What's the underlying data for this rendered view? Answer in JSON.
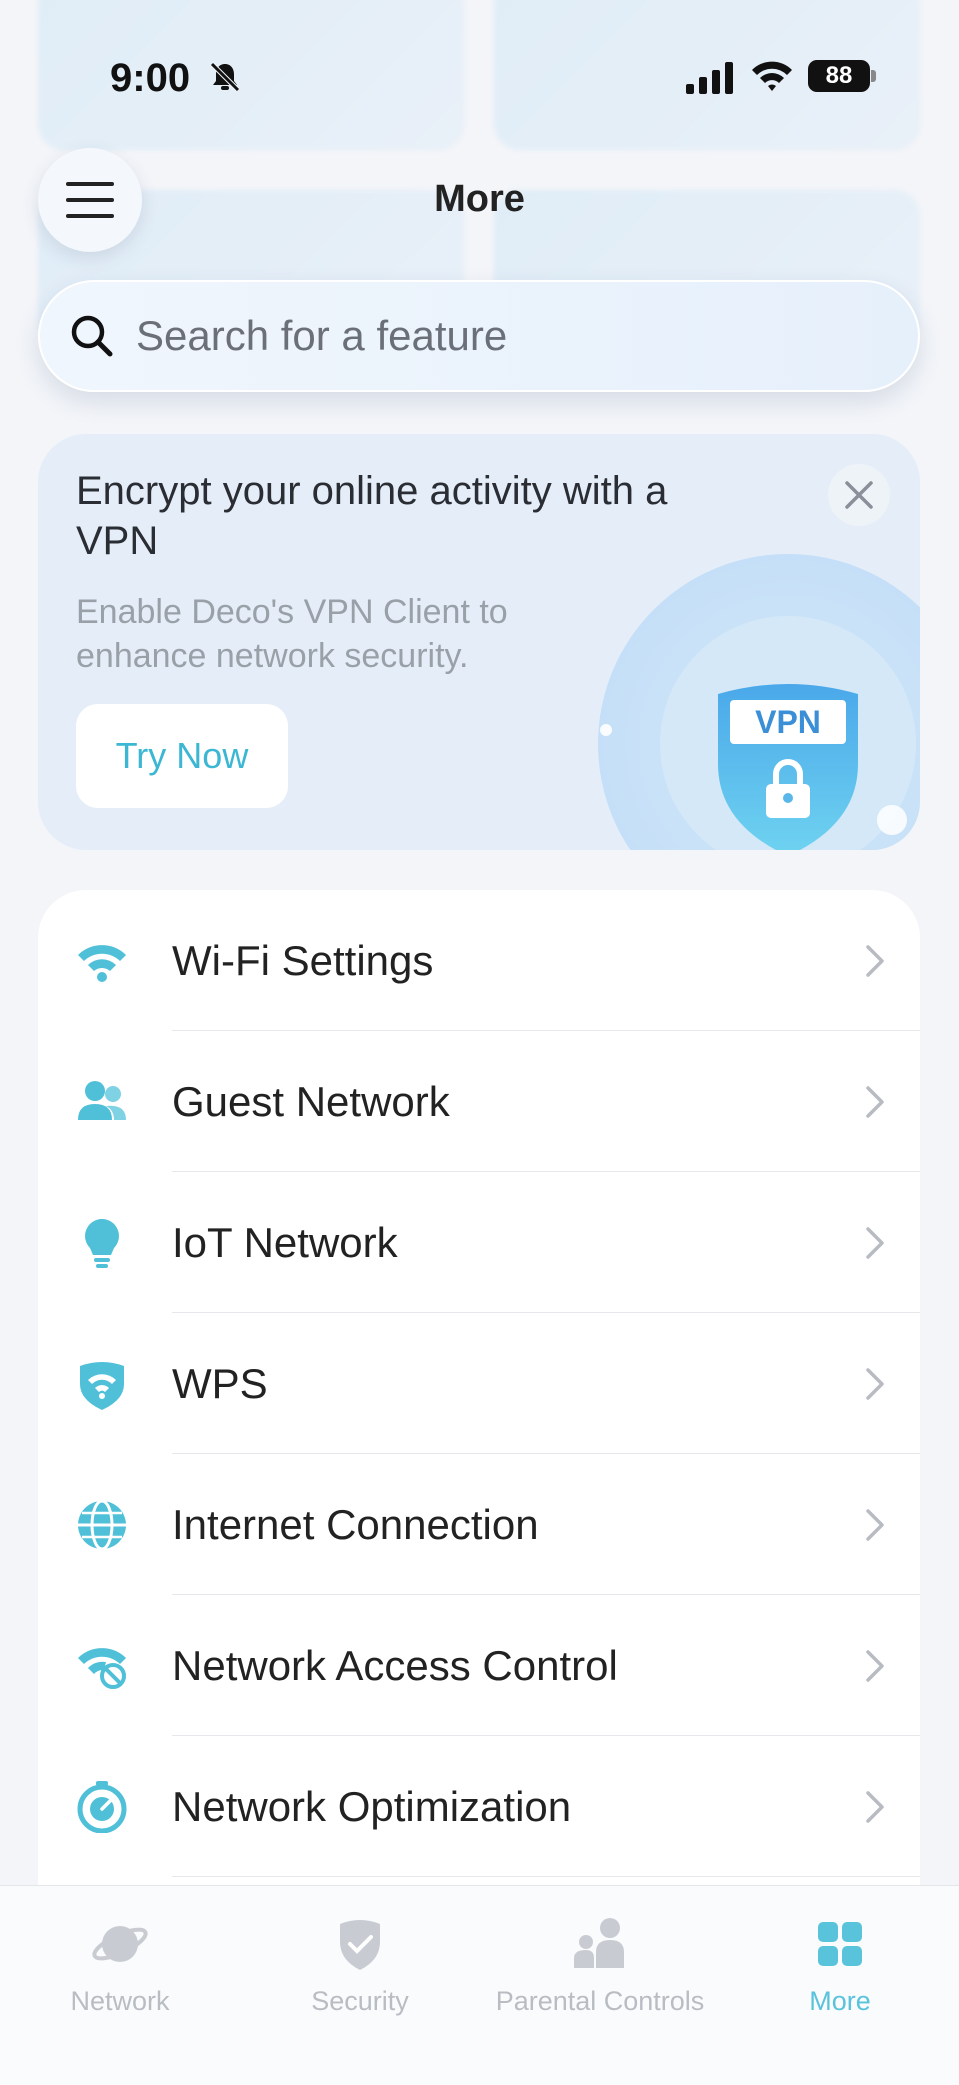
{
  "status_bar": {
    "time": "9:00",
    "battery": "88"
  },
  "header": {
    "title": "More",
    "search_placeholder": "Search for a feature"
  },
  "vpn_promo": {
    "title": "Encrypt your online activity with a VPN",
    "description": "Enable Deco's VPN Client to enhance network security.",
    "button": "Try Now",
    "badge_text": "VPN"
  },
  "settings": [
    {
      "label": "Wi-Fi Settings",
      "icon": "wifi-icon"
    },
    {
      "label": "Guest Network",
      "icon": "users-icon"
    },
    {
      "label": "IoT Network",
      "icon": "lightbulb-icon"
    },
    {
      "label": "WPS",
      "icon": "shield-wifi-icon"
    },
    {
      "label": "Internet Connection",
      "icon": "globe-icon"
    },
    {
      "label": "Network Access Control",
      "icon": "wifi-block-icon"
    },
    {
      "label": "Network Optimization",
      "icon": "speedometer-icon"
    }
  ],
  "tabs": [
    {
      "label": "Network",
      "icon": "planet-icon",
      "active": false
    },
    {
      "label": "Security",
      "icon": "shield-check-icon",
      "active": false
    },
    {
      "label": "Parental Controls",
      "icon": "family-icon",
      "active": false
    },
    {
      "label": "More",
      "icon": "grid-icon",
      "active": true
    }
  ],
  "colors": {
    "accent": "#5ac3dc",
    "icon_teal": "#4fc0d8",
    "inactive_tab": "#b9bdc3"
  }
}
